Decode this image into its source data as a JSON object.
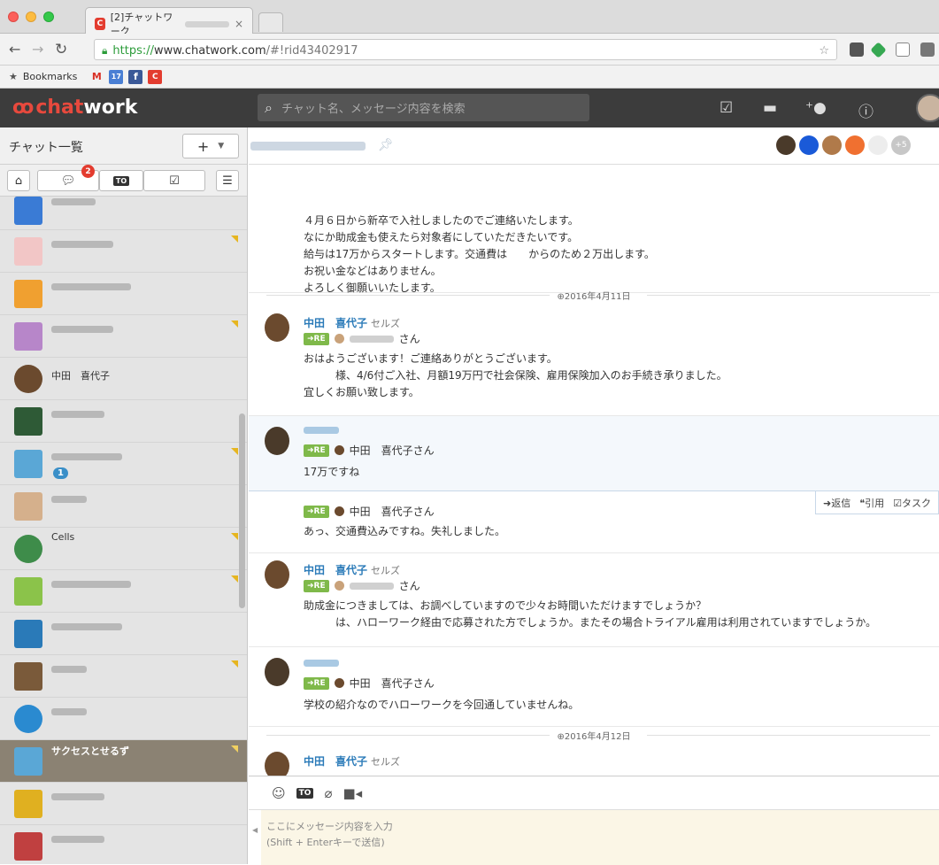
{
  "browser": {
    "tab_title": "[2]チャットワーク",
    "url_protocol": "https://",
    "url_host": "www.chatwork.com",
    "url_path": "/#!rid43402917",
    "bookmarks_label": "Bookmarks"
  },
  "header": {
    "logo_chat": "chat",
    "logo_work": "work",
    "search_placeholder": "チャット名、メッセージ内容を検索"
  },
  "sidebar": {
    "title": "チャット一覧",
    "add_label": "+",
    "mention_badge": "2",
    "rooms": [
      {
        "name": "",
        "color": "#3a7bd5"
      },
      {
        "name": "",
        "color": "#f2c6c6"
      },
      {
        "name": "",
        "color": "#f0a030"
      },
      {
        "name": "",
        "color": "#b786c9"
      },
      {
        "name": "中田　喜代子",
        "color": "#6b4a2e"
      },
      {
        "name": "",
        "color": "#2e5a36"
      },
      {
        "name": "",
        "color": "#5aa7d6",
        "mention": "1"
      },
      {
        "name": "",
        "color": "#d5b08c"
      },
      {
        "name": "Cells",
        "color": "#3e8c4a"
      },
      {
        "name": "",
        "color": "#8bc34a"
      },
      {
        "name": "",
        "color": "#2a7ab8"
      },
      {
        "name": "",
        "color": "#7a5a3a"
      },
      {
        "name": "",
        "color": "#2a8ad0"
      },
      {
        "name": "サクセスとせるず",
        "color": "#5aa7d6"
      },
      {
        "name": "",
        "color": "#e0b020"
      },
      {
        "name": "",
        "color": "#c04040"
      }
    ]
  },
  "room": {
    "more_members": "+5"
  },
  "messages": {
    "m1_lines": [
      "４月６日から新卒で入社しましたのでご連絡いたします。",
      "なにか助成金も使えたら対象者にしていただきたいです。",
      "給与は17万からスタートします。交通費は　　からのため２万出します。",
      "お祝い金などはありません。",
      "よろしく御願いいたします。"
    ],
    "date1": "⊕2016年4月11日",
    "m2_sender": "中田　喜代子",
    "m2_org": "セルズ",
    "re_label": "➜RE",
    "m2_re_suffix": "さん",
    "m2_lines": [
      "おはようございます！ご連絡ありがとうございます。",
      "　　　様、4/6付ご入社、月額19万円で社会保険、雇用保険加入のお手続き承りました。",
      "宜しくお願い致します。"
    ],
    "m3_re_target": "中田　喜代子さん",
    "m3_text": "17万ですね",
    "actions": {
      "reply": "➜返信",
      "quote": "引用",
      "task": "タスク"
    },
    "m4_re_target": "中田　喜代子さん",
    "m4_text": "あっ、交通費込みですね。失礼しました。",
    "m5_sender": "中田　喜代子",
    "m5_org": "セルズ",
    "m5_re_suffix": "さん",
    "m5_lines": [
      "助成金につきましては、お調べしていますので少々お時間いただけますでしょうか？",
      "　　　は、ハローワーク経由で応募された方でしょうか。またその場合トライアル雇用は利用されていますでしょうか。"
    ],
    "m6_re_target": "中田　喜代子さん",
    "m6_text": "学校の紹介なのでハローワークを今回通していませんね。",
    "date2": "⊕2016年4月12日",
    "m7_sender": "中田　喜代子",
    "m7_org": "セルズ"
  },
  "composer": {
    "placeholder_line1": "ここにメッセージ内容を入力",
    "placeholder_line2": "(Shift + Enterキーで送信)"
  }
}
